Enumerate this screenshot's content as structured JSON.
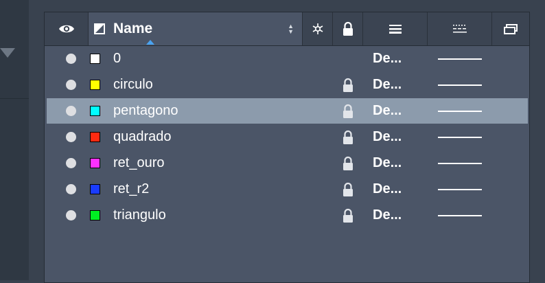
{
  "header": {
    "visibility_icon": "eye-icon",
    "name_type_icon": "half-square-icon",
    "name_label": "Name",
    "freeze_icon": "snowflake-icon",
    "lock_icon": "lock-icon",
    "lineweight_icon": "lineweight-icon",
    "linetype_icon": "linetype-icon",
    "plot_icon": "plot-style-icon"
  },
  "colors": {
    "panel_bg": "#4b5567",
    "header_bg": "#3b4452",
    "selected_row_bg": "#8c9bac",
    "sort_indicator": "#4aa3f0"
  },
  "layers": [
    {
      "name": "0",
      "swatch": "#ffffff",
      "locked": false,
      "color_label": "De...",
      "selected": false
    },
    {
      "name": "circulo",
      "swatch": "#ffff00",
      "locked": true,
      "color_label": "De...",
      "selected": false
    },
    {
      "name": "pentagono",
      "swatch": "#00ffff",
      "locked": true,
      "color_label": "De...",
      "selected": true
    },
    {
      "name": "quadrado",
      "swatch": "#ff2a10",
      "locked": true,
      "color_label": "De...",
      "selected": false
    },
    {
      "name": "ret_ouro",
      "swatch": "#ff30ff",
      "locked": true,
      "color_label": "De...",
      "selected": false
    },
    {
      "name": "ret_r2",
      "swatch": "#1a3cff",
      "locked": true,
      "color_label": "De...",
      "selected": false
    },
    {
      "name": "triangulo",
      "swatch": "#00ee22",
      "locked": true,
      "color_label": "De...",
      "selected": false
    }
  ]
}
